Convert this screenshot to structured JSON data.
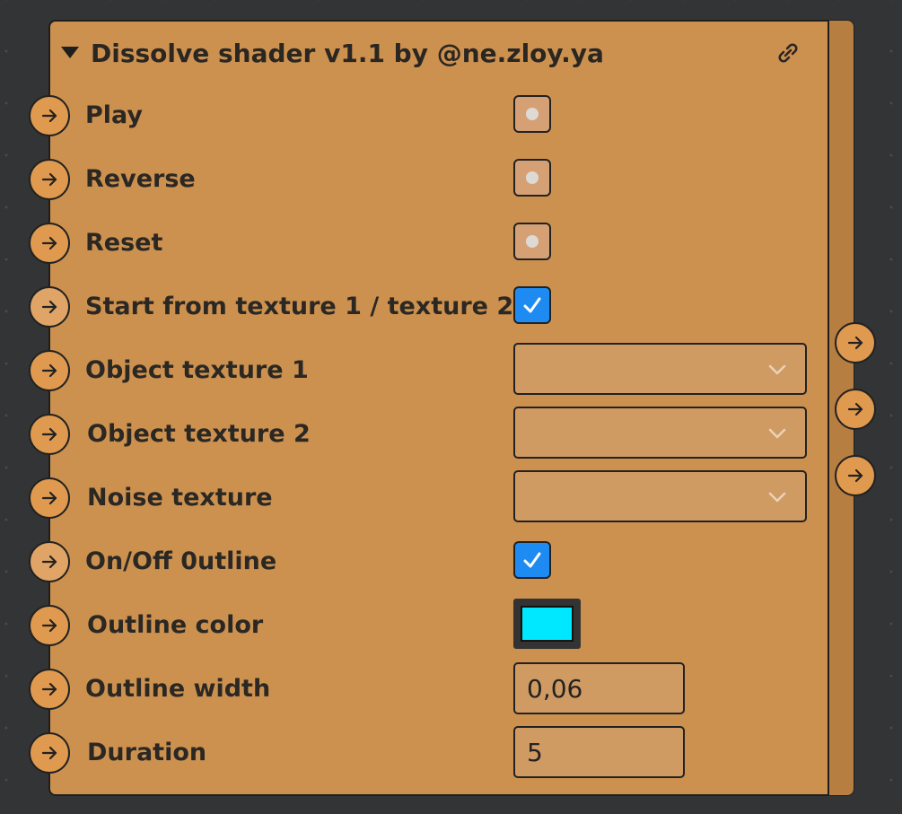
{
  "node": {
    "title": "Dissolve shader v1.1 by @ne.zloy.ya",
    "header_icon": "link-icon",
    "collapse_icon": "triangle-down-icon"
  },
  "colors": {
    "background": "#333436",
    "node_body": "#cd914f",
    "node_rail": "#b77e42",
    "port": "#df9a4f",
    "checkbox_checked": "#1e8bf2",
    "outline_color_value": "#00e8ff"
  },
  "inputs": [
    {
      "label": "Play",
      "control": "trigger"
    },
    {
      "label": "Reverse",
      "control": "trigger"
    },
    {
      "label": "Reset",
      "control": "trigger"
    },
    {
      "label": "Start from texture 1 / texture 2",
      "control": "checkbox",
      "checked": true
    },
    {
      "label": "Object texture 1",
      "control": "dropdown"
    },
    {
      "label": "Object texture 2",
      "control": "dropdown"
    },
    {
      "label": "Noise texture",
      "control": "dropdown"
    },
    {
      "label": "On/Off 0utline",
      "control": "checkbox",
      "checked": true
    },
    {
      "label": "Outline color",
      "control": "color"
    },
    {
      "label": "Outline width",
      "control": "number",
      "value": "0,06"
    },
    {
      "label": "Duration",
      "control": "number",
      "value": "5"
    }
  ],
  "output_port_count": 3
}
